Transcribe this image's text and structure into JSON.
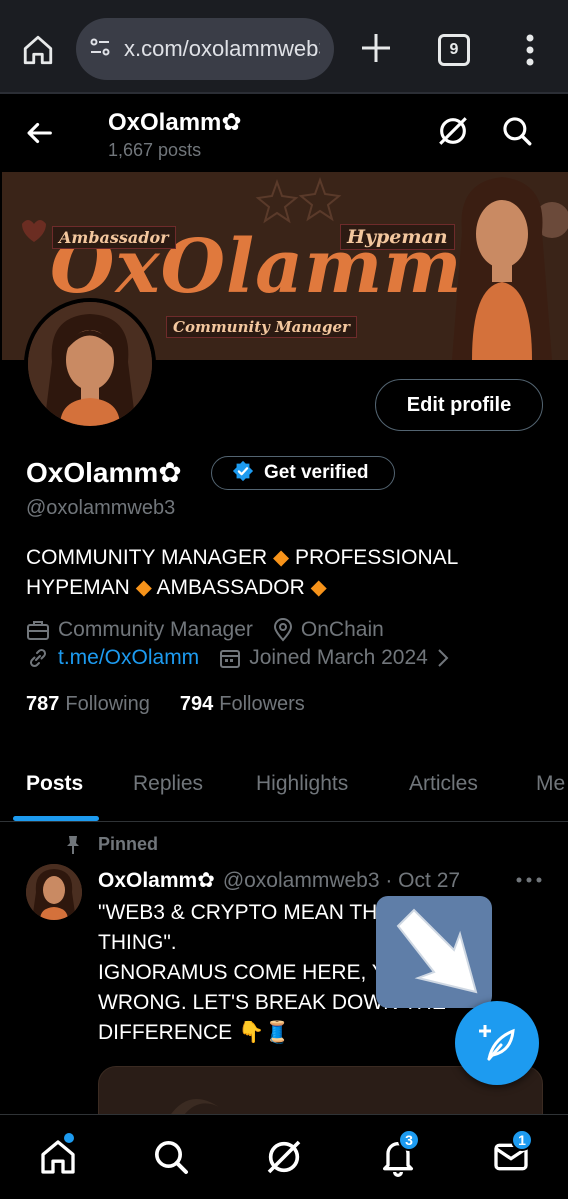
{
  "browser": {
    "url": "x.com/oxolammweb3",
    "tab_count": "9"
  },
  "header": {
    "name": "OxOlamm✿",
    "posts_count": "1,667 posts"
  },
  "banner": {
    "title": "OxOlamm",
    "tags": [
      "Ambassador",
      "Hypeman",
      "Community Manager"
    ]
  },
  "profile": {
    "edit_label": "Edit profile",
    "display_name": "OxOlamm✿",
    "verify_label": "Get verified",
    "handle": "@oxolammweb3",
    "bio_line1_a": "COMMUNITY MANAGER",
    "bio_line1_b": "PROFESSIONAL",
    "bio_line2_a": "HYPEMAN",
    "bio_line2_b": "AMBASSADOR",
    "diamond": "◆",
    "category": "Community Manager",
    "location": "OnChain",
    "link": "t.me/OxOlamm",
    "joined": "Joined March 2024",
    "following_count": "787",
    "following_label": "Following",
    "followers_count": "794",
    "followers_label": "Followers"
  },
  "tabs": [
    "Posts",
    "Replies",
    "Highlights",
    "Articles",
    "Me"
  ],
  "tweet": {
    "pinned_label": "Pinned",
    "author": "OxOlamm✿",
    "meta": "@oxolammweb3 · Oct 27",
    "lines": [
      "\"WEB3 & CRYPTO MEAN TH",
      "THING\".",
      "IGNORAMUS COME HERE, Y",
      "WRONG. LET'S BREAK DOWN THE",
      "DIFFERENCE 👇🧵"
    ]
  },
  "nav": {
    "notifications_badge": "3",
    "messages_badge": "1"
  },
  "colors": {
    "accent": "#1d9bf0",
    "diamond": "#f7931a",
    "banner_text": "#e0793d"
  }
}
